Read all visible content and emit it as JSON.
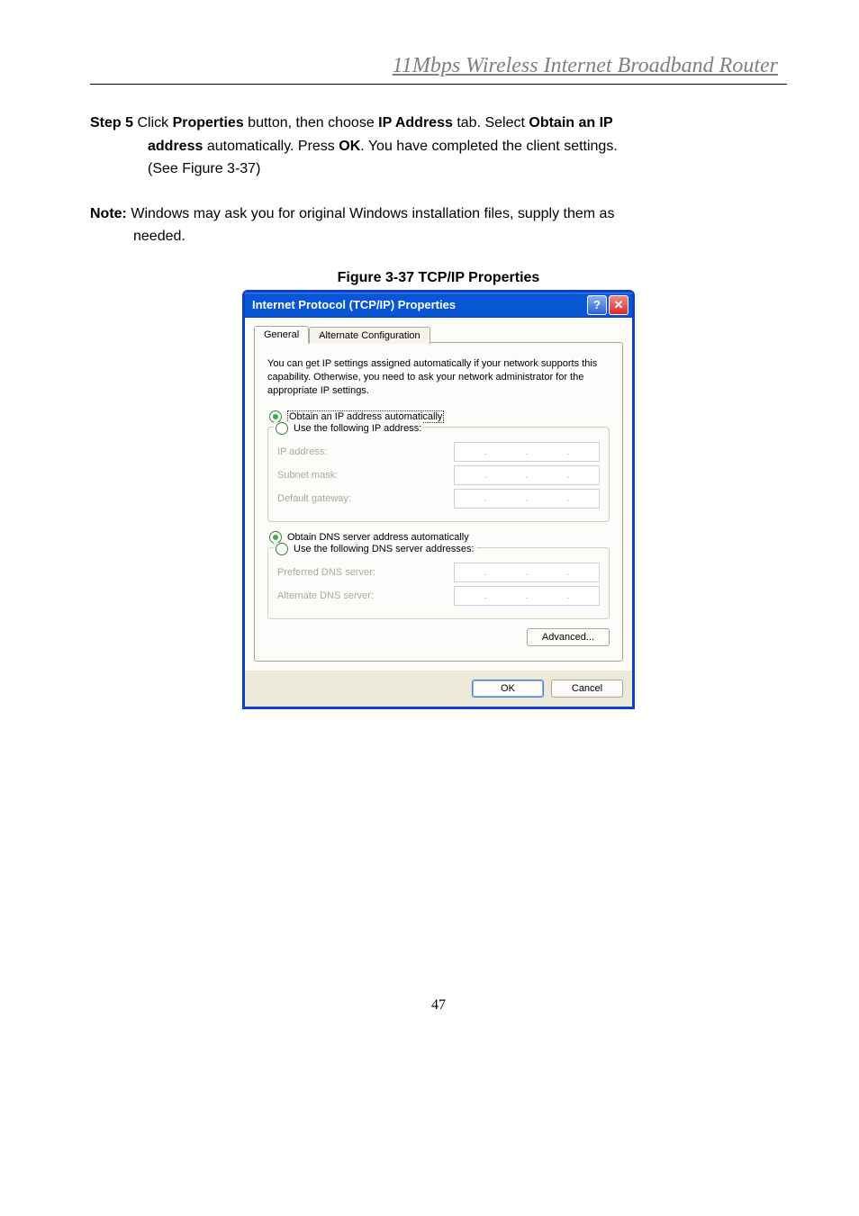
{
  "header": {
    "title": "11Mbps  Wireless  Internet  Broadband  Router"
  },
  "step": {
    "label": "Step 5",
    "line1_a": " Click ",
    "line1_b": "Properties",
    "line1_c": " button, then choose ",
    "line1_d": "IP Address",
    "line1_e": " tab. Select ",
    "line1_f": "Obtain an IP",
    "line2_a": "address",
    "line2_b": " automatically. Press ",
    "line2_c": "OK",
    "line2_d": ". You have completed the client settings.",
    "line3": "(See Figure 3-37)"
  },
  "note": {
    "label": "Note:",
    "line1": " Windows may ask you for original Windows installation files, supply them as",
    "line2": "needed."
  },
  "figure_caption": "Figure 3-37 TCP/IP Properties",
  "dialog": {
    "title": "Internet Protocol (TCP/IP) Properties",
    "help_glyph": "?",
    "close_glyph": "✕",
    "tabs": {
      "general": "General",
      "alt": "Alternate Configuration"
    },
    "info": "You can get IP settings assigned automatically if your network supports this capability. Otherwise, you need to ask your network administrator for the appropriate IP settings.",
    "radios": {
      "obtain_ip": "Obtain an IP address automatically",
      "use_ip": "Use the following IP address:",
      "obtain_dns": "Obtain DNS server address automatically",
      "use_dns": "Use the following DNS server addresses:"
    },
    "fields": {
      "ip": "IP address:",
      "subnet": "Subnet mask:",
      "gateway": "Default gateway:",
      "pref_dns": "Preferred DNS server:",
      "alt_dns": "Alternate DNS server:"
    },
    "dot": ".",
    "buttons": {
      "advanced": "Advanced...",
      "ok": "OK",
      "cancel": "Cancel"
    }
  },
  "page_number": "47"
}
